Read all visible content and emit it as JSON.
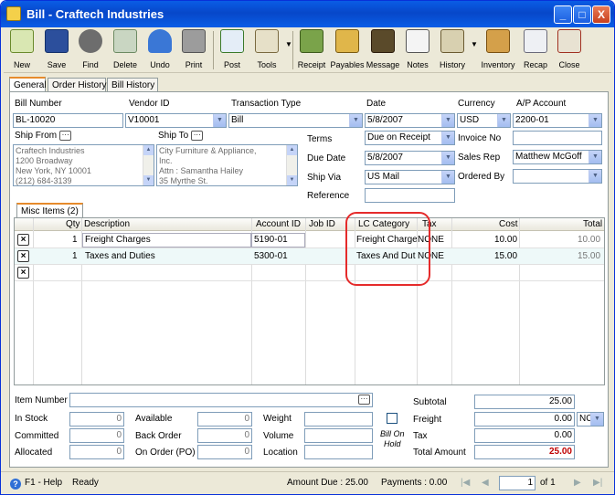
{
  "window": {
    "title": "Bill - Craftech Industries",
    "min": "_",
    "max": "□",
    "close": "X"
  },
  "toolbar": [
    "New",
    "Save",
    "Find",
    "Delete",
    "Undo",
    "Print",
    "Post",
    "Tools",
    "Receipt",
    "Payables",
    "Message",
    "Notes",
    "History",
    "Inventory",
    "Recap",
    "Close"
  ],
  "tabs": [
    "General",
    "Order History",
    "Bill History"
  ],
  "header": {
    "bill_number_label": "Bill Number",
    "bill_number": "BL-10020",
    "vendor_label": "Vendor ID",
    "vendor": "V10001",
    "trans_type_label": "Transaction Type",
    "trans_type": "Bill",
    "date_label": "Date",
    "date": "5/8/2007",
    "currency_label": "Currency",
    "currency": "USD",
    "ap_label": "A/P Account",
    "ap": "2200-01",
    "ship_from_label": "Ship From",
    "ship_from": [
      "Craftech Industries",
      "1200 Broadway",
      "New York, NY 10001",
      "(212) 684-3139"
    ],
    "ship_to_label": "Ship To",
    "ship_to": [
      "City Furniture & Appliance,",
      "Inc.",
      "Attn : Samantha Hailey",
      "35 Myrthe St."
    ],
    "terms_label": "Terms",
    "terms": "Due on Receipt",
    "invoice_label": "Invoice No",
    "invoice": "",
    "due_label": "Due Date",
    "due": "5/8/2007",
    "salesrep_label": "Sales Rep",
    "salesrep": "Matthew McGoff",
    "shipvia_label": "Ship Via",
    "shipvia": "US Mail",
    "orderedby_label": "Ordered By",
    "orderedby": "",
    "reference_label": "Reference",
    "reference": ""
  },
  "misc_tab": "Misc Items (2)",
  "grid": {
    "columns": [
      "Qty",
      "Description",
      "Account ID",
      "Job ID",
      "LC Category",
      "Tax",
      "Cost",
      "Total"
    ],
    "rows": [
      {
        "qty": "1",
        "desc": "Freight Charges",
        "account": "5190-01",
        "job": "",
        "lc": "Freight Charge",
        "tax": "NONE",
        "cost": "10.00",
        "total": "10.00"
      },
      {
        "qty": "1",
        "desc": "Taxes and Duties",
        "account": "5300-01",
        "job": "",
        "lc": "Taxes And Dut",
        "tax": "NONE",
        "cost": "15.00",
        "total": "15.00"
      }
    ]
  },
  "footer": {
    "item_number_label": "Item Number",
    "instock_label": "In Stock",
    "instock": "0",
    "available_label": "Available",
    "available": "0",
    "weight_label": "Weight",
    "committed_label": "Committed",
    "committed": "0",
    "backorder_label": "Back Order",
    "backorder": "0",
    "volume_label": "Volume",
    "allocated_label": "Allocated",
    "allocated": "0",
    "onorder_label": "On Order (PO)",
    "onorder": "0",
    "location_label": "Location",
    "billonhold_line1": "Bill On",
    "billonhold_line2": "Hold",
    "subtotal_label": "Subtotal",
    "subtotal": "25.00",
    "freight_label": "Freight",
    "freight": "0.00",
    "freight_code": "NC",
    "tax_label": "Tax",
    "tax": "0.00",
    "total_label": "Total Amount",
    "total": "25.00"
  },
  "status": {
    "help": "F1 - Help",
    "ready": "Ready",
    "amount_due": "Amount Due : 25.00",
    "payments": "Payments : 0.00",
    "page": "1",
    "of": "of 1"
  }
}
